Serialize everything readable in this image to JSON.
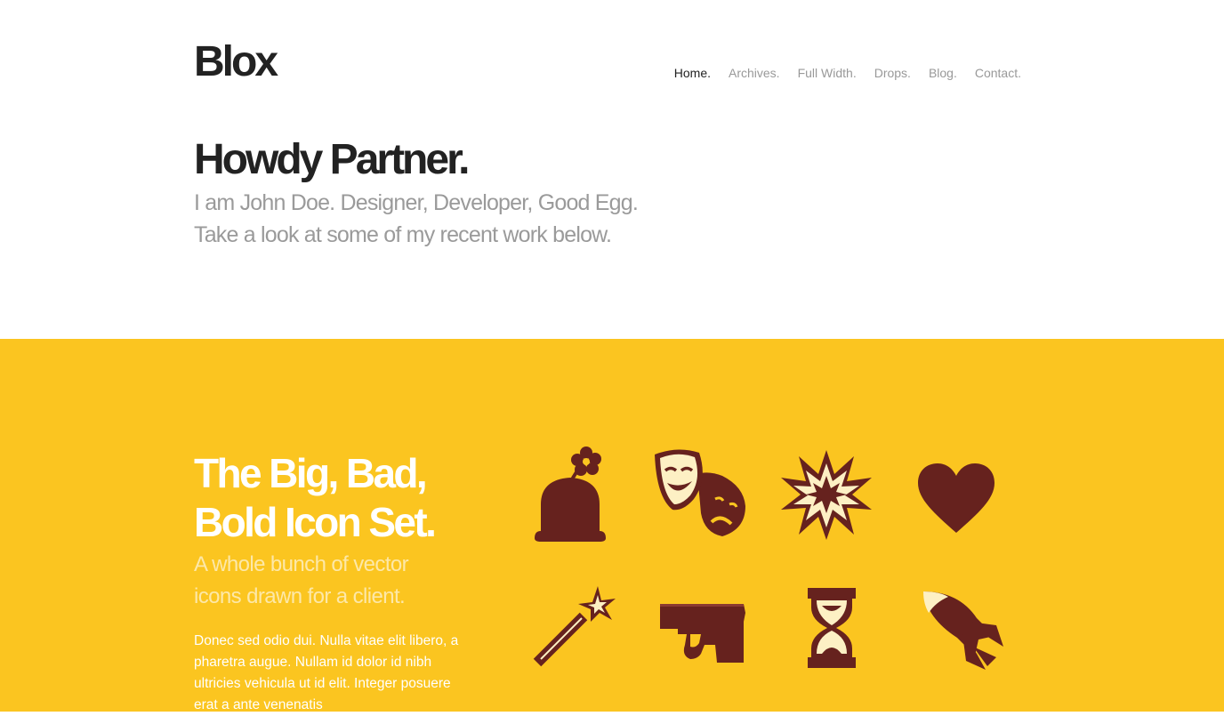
{
  "site": {
    "logo": "Blox"
  },
  "nav": {
    "items": [
      {
        "label": "Home.",
        "active": true
      },
      {
        "label": "Archives.",
        "active": false
      },
      {
        "label": "Full Width.",
        "active": false
      },
      {
        "label": "Drops.",
        "active": false
      },
      {
        "label": "Blog.",
        "active": false
      },
      {
        "label": "Contact.",
        "active": false
      }
    ]
  },
  "hero": {
    "title": "Howdy Partner.",
    "subtitle_line1": "I am John Doe. Designer, Developer, Good Egg.",
    "subtitle_line2": "Take a look at some of my recent work below."
  },
  "project": {
    "title_line1": "The Big, Bad,",
    "title_line2": "Bold Icon Set.",
    "subtitle_line1": "A whole bunch of vector",
    "subtitle_line2": "icons drawn for a client.",
    "body": "Donec sed odio dui. Nulla vitae elit libero, a pharetra augue. Nullam id dolor id nibh ultricies vehicula ut id elit. Integer posuere erat a ante venenatis",
    "icons": [
      "bowler-hat-flower-icon",
      "theater-masks-icon",
      "explosion-icon",
      "heart-icon",
      "magic-wand-icon",
      "pistol-icon",
      "hourglass-icon",
      "rocket-icon"
    ]
  },
  "colors": {
    "band": "#fbc520",
    "icon": "#66221e",
    "icon_light": "#fdf0c4",
    "text_dark": "#222222",
    "text_muted": "#999999"
  }
}
